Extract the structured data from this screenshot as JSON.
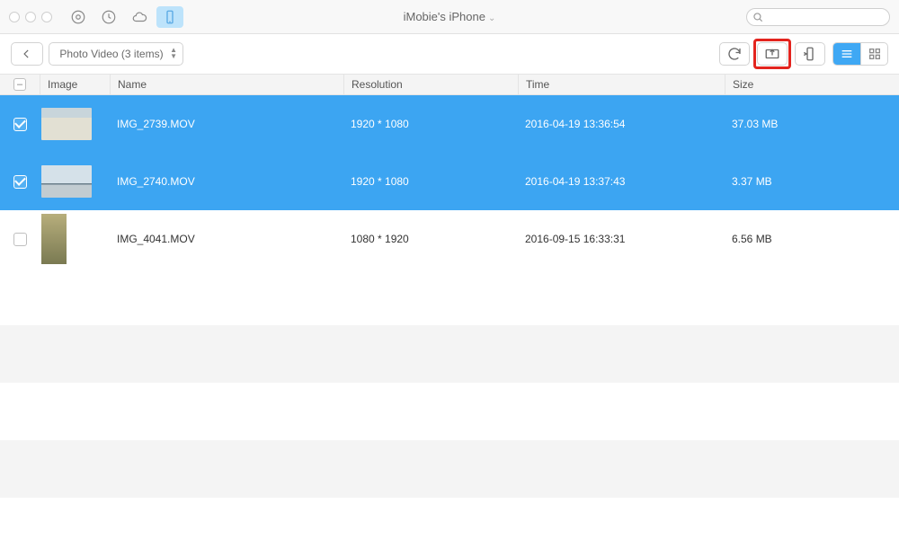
{
  "header": {
    "title": "iMobie's iPhone"
  },
  "search": {
    "placeholder": ""
  },
  "toolbar": {
    "breadcrumb_label": "Photo Video (3 items)"
  },
  "columns": {
    "image": "Image",
    "name": "Name",
    "resolution": "Resolution",
    "time": "Time",
    "size": "Size"
  },
  "rows": [
    {
      "selected": true,
      "name": "IMG_2739.MOV",
      "resolution": "1920 * 1080",
      "time": "2016-04-19 13:36:54",
      "size": "37.03 MB"
    },
    {
      "selected": true,
      "name": "IMG_2740.MOV",
      "resolution": "1920 * 1080",
      "time": "2016-04-19 13:37:43",
      "size": "3.37 MB"
    },
    {
      "selected": false,
      "name": "IMG_4041.MOV",
      "resolution": "1080 * 1920",
      "time": "2016-09-15 16:33:31",
      "size": "6.56 MB"
    }
  ]
}
